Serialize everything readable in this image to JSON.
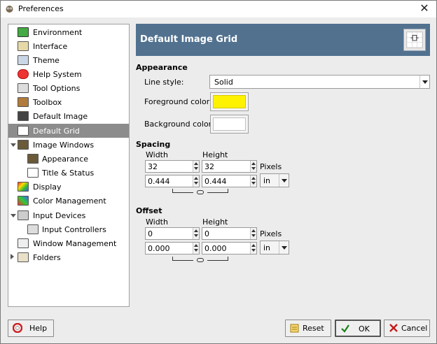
{
  "window": {
    "title": "Preferences"
  },
  "sidebar": {
    "items": [
      {
        "label": "Environment",
        "level": 0,
        "icon": "environment-icon"
      },
      {
        "label": "Interface",
        "level": 0,
        "icon": "interface-icon"
      },
      {
        "label": "Theme",
        "level": 0,
        "icon": "theme-icon"
      },
      {
        "label": "Help System",
        "level": 0,
        "icon": "help-system-icon"
      },
      {
        "label": "Tool Options",
        "level": 0,
        "icon": "tool-options-icon"
      },
      {
        "label": "Toolbox",
        "level": 0,
        "icon": "toolbox-icon"
      },
      {
        "label": "Default Image",
        "level": 0,
        "icon": "default-image-icon"
      },
      {
        "label": "Default Grid",
        "level": 0,
        "icon": "default-grid-icon",
        "selected": true
      },
      {
        "label": "Image Windows",
        "level": 0,
        "icon": "image-windows-icon",
        "expanded": true
      },
      {
        "label": "Appearance",
        "level": 1,
        "icon": "appearance-icon"
      },
      {
        "label": "Title & Status",
        "level": 1,
        "icon": "title-status-icon"
      },
      {
        "label": "Display",
        "level": 0,
        "icon": "display-icon"
      },
      {
        "label": "Color Management",
        "level": 0,
        "icon": "color-management-icon"
      },
      {
        "label": "Input Devices",
        "level": 0,
        "icon": "input-devices-icon",
        "expanded": true
      },
      {
        "label": "Input Controllers",
        "level": 1,
        "icon": "input-controllers-icon"
      },
      {
        "label": "Window Management",
        "level": 0,
        "icon": "window-management-icon"
      },
      {
        "label": "Folders",
        "level": 0,
        "icon": "folders-icon",
        "expanded": false
      }
    ]
  },
  "header": {
    "title": "Default Image Grid",
    "icon": "grid-icon"
  },
  "appearance": {
    "section_label": "Appearance",
    "line_style_label": "Line style:",
    "line_style_value": "Solid",
    "foreground_label": "Foreground color:",
    "foreground_color": "#fff200",
    "background_label": "Background color:",
    "background_color": "#ffffff"
  },
  "spacing": {
    "section_label": "Spacing",
    "width_label": "Width",
    "height_label": "Height",
    "width_px": "32",
    "height_px": "32",
    "pixels_label": "Pixels",
    "width_in": "0.444",
    "height_in": "0.444",
    "unit": "in"
  },
  "offset": {
    "section_label": "Offset",
    "width_label": "Width",
    "height_label": "Height",
    "width_px": "0",
    "height_px": "0",
    "pixels_label": "Pixels",
    "width_in": "0.000",
    "height_in": "0.000",
    "unit": "in"
  },
  "buttons": {
    "help": "Help",
    "reset": "Reset",
    "ok": "OK",
    "cancel": "Cancel"
  },
  "colors": {
    "header_bg": "#51718f",
    "selection_bg": "#8c8c8c"
  }
}
